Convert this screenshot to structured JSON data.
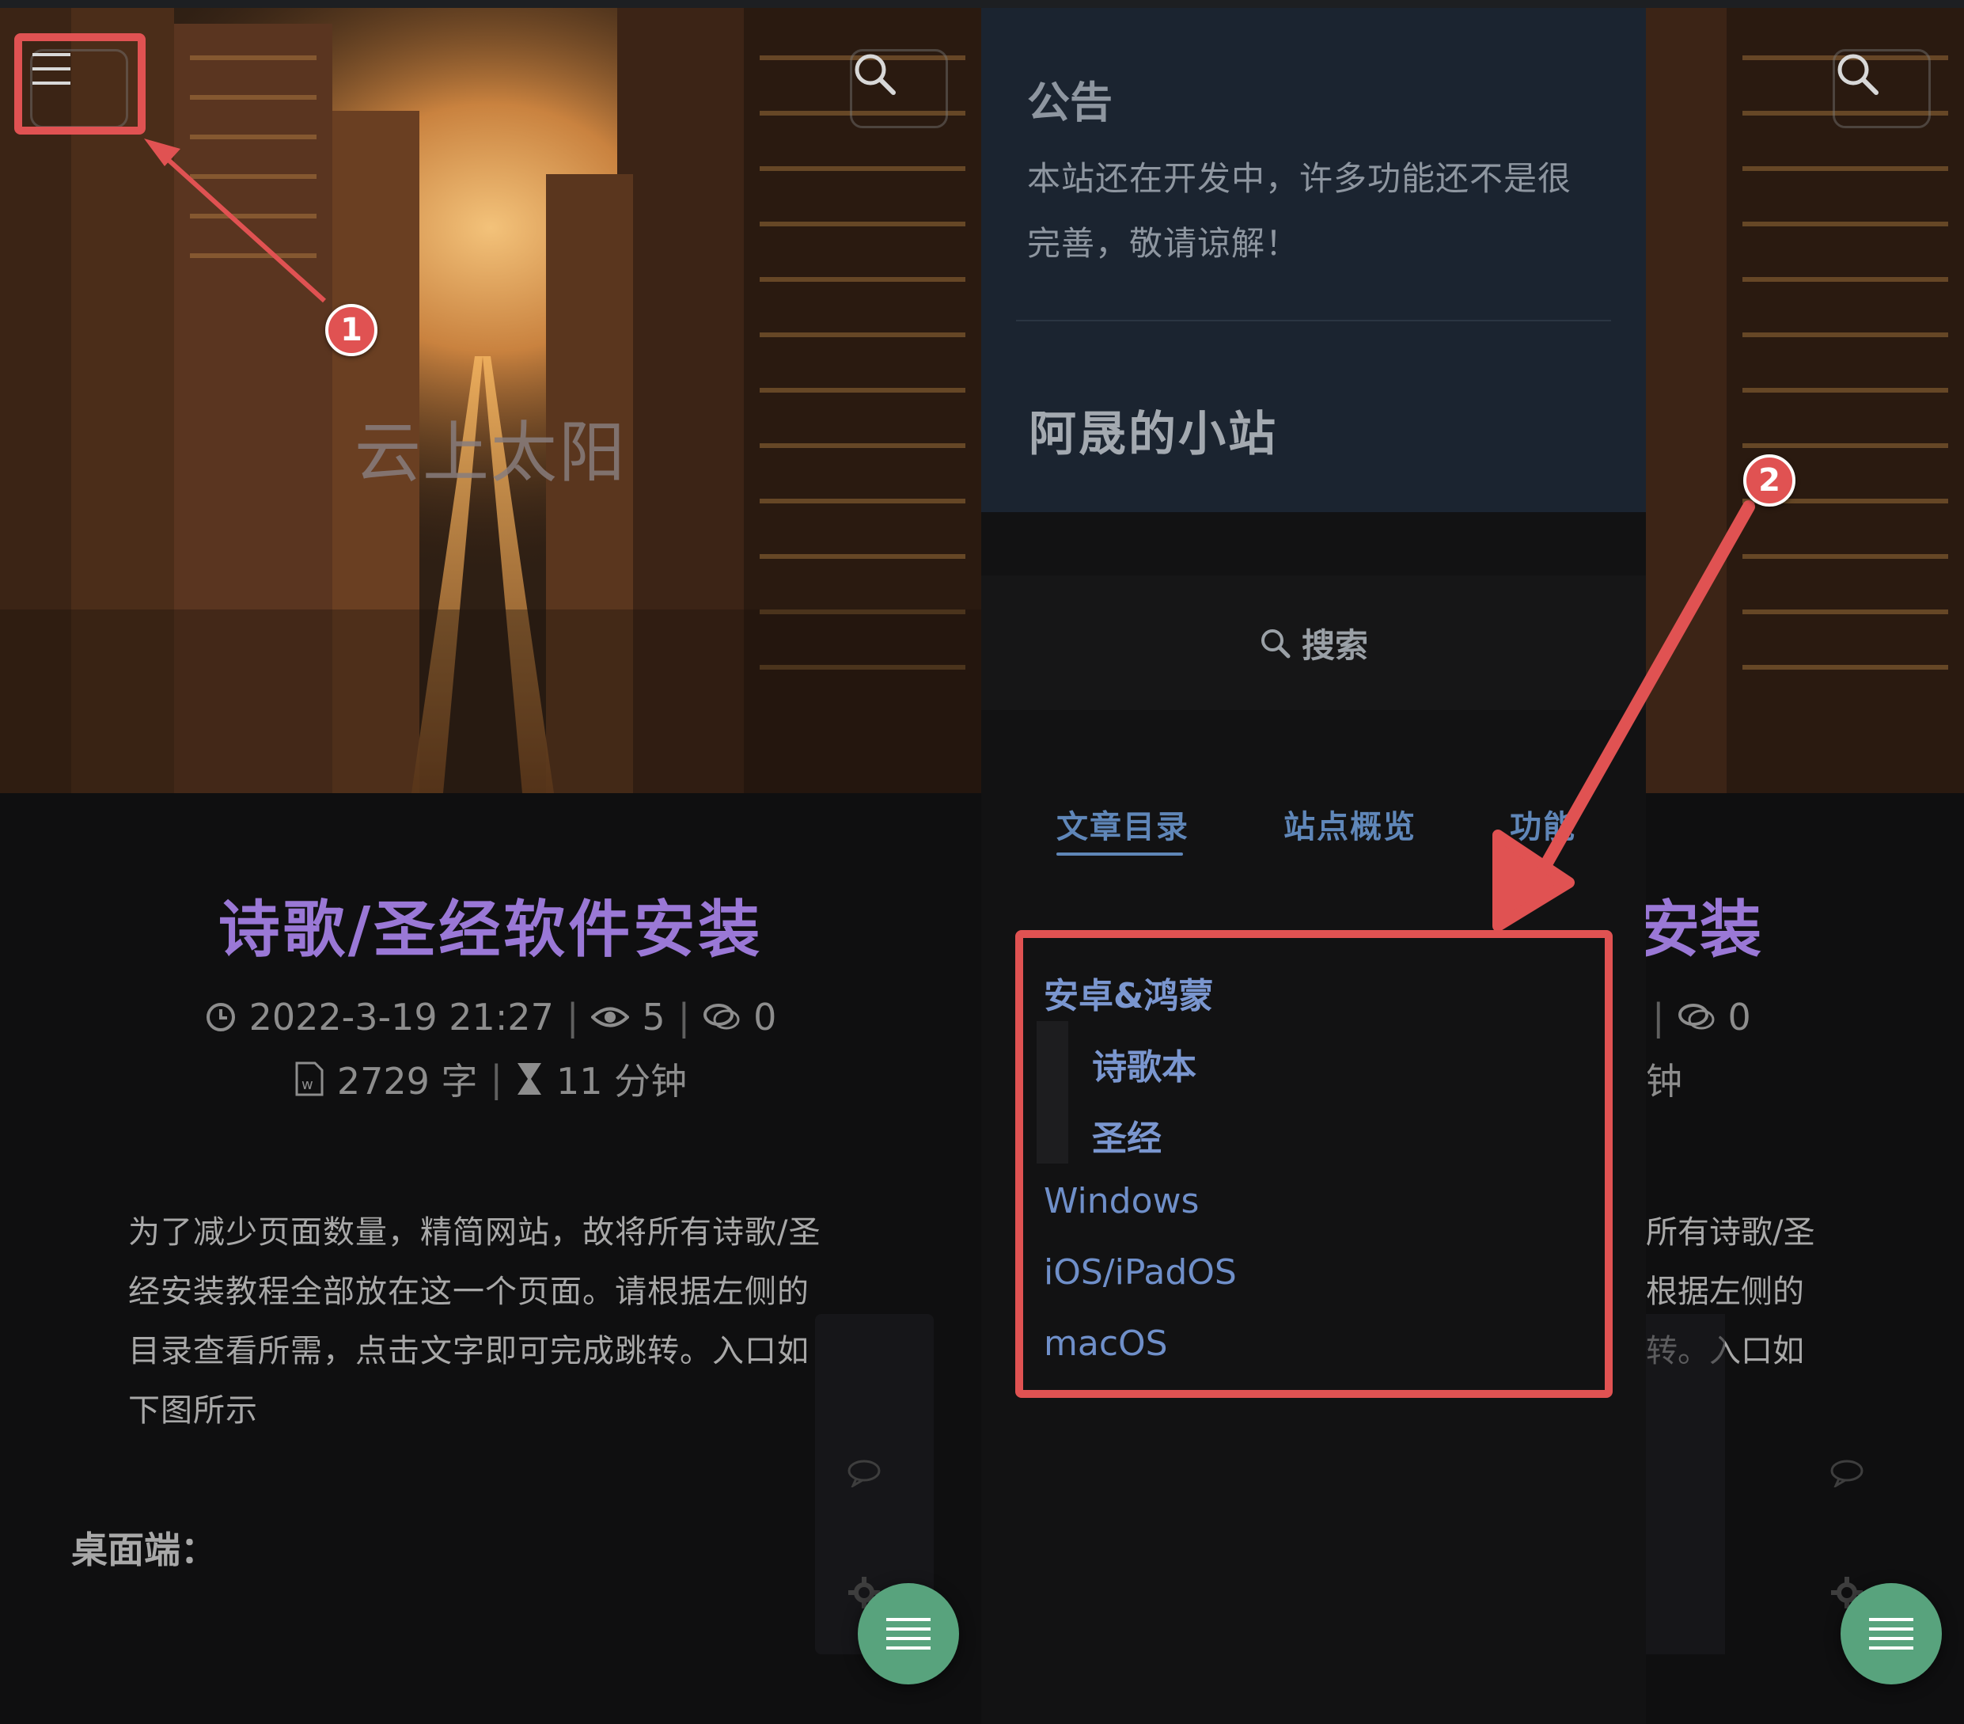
{
  "article": {
    "hero_title": "云上太阳",
    "title": "诗歌/圣经软件安装",
    "datetime": "2022-3-19 21:27",
    "views": "5",
    "comments": "0",
    "word_count": "2729 字",
    "read_time": "11 分钟",
    "meta_separator": "|",
    "body_lines": [
      "为了减少页面数量，精简网站，故将所有诗歌/圣",
      "经安装教程全部放在这一个页面。请根据左侧的",
      "目录查看所需，点击文字即可完成跳转。入口如",
      "下图所示"
    ],
    "section_heading": "桌面端："
  },
  "right_peek": {
    "title_fragment": "安装",
    "comments": "0",
    "read_time_fragment": "钟",
    "body_fragments": [
      "所有诗歌/圣",
      "根据左侧的",
      "转。入口如"
    ]
  },
  "drawer": {
    "notice_title": "公告",
    "notice_text_lines": [
      "本站还在开发中，许多功能还不是很",
      "完善，敬请谅解！"
    ],
    "site_name": "阿晟的小站",
    "search_label": "搜索",
    "tabs": [
      {
        "label": "文章目录",
        "active": true
      },
      {
        "label": "站点概览",
        "active": false
      },
      {
        "label": "功能",
        "active": false
      }
    ],
    "toc": [
      {
        "label": "安卓&鸿蒙",
        "level": 1
      },
      {
        "label": "诗歌本",
        "level": 2
      },
      {
        "label": "圣经",
        "level": 2
      },
      {
        "label": "Windows",
        "level": 1
      },
      {
        "label": "iOS/iPadOS",
        "level": 1
      },
      {
        "label": "macOS",
        "level": 1
      }
    ]
  },
  "annotations": {
    "badge_1": "1",
    "badge_2": "2"
  },
  "icons": [
    "menu-icon",
    "search-icon",
    "clock-icon",
    "eye-icon",
    "comment-icon",
    "word-file-icon",
    "hourglass-icon",
    "gear-icon",
    "list-icon"
  ],
  "colors": {
    "accent_purple": "#9a78d6",
    "toc_blue": "#6f8fc9",
    "fab_green": "#58a37d",
    "annotation_red": "#e05252",
    "notice_bg": "#1b2430"
  }
}
